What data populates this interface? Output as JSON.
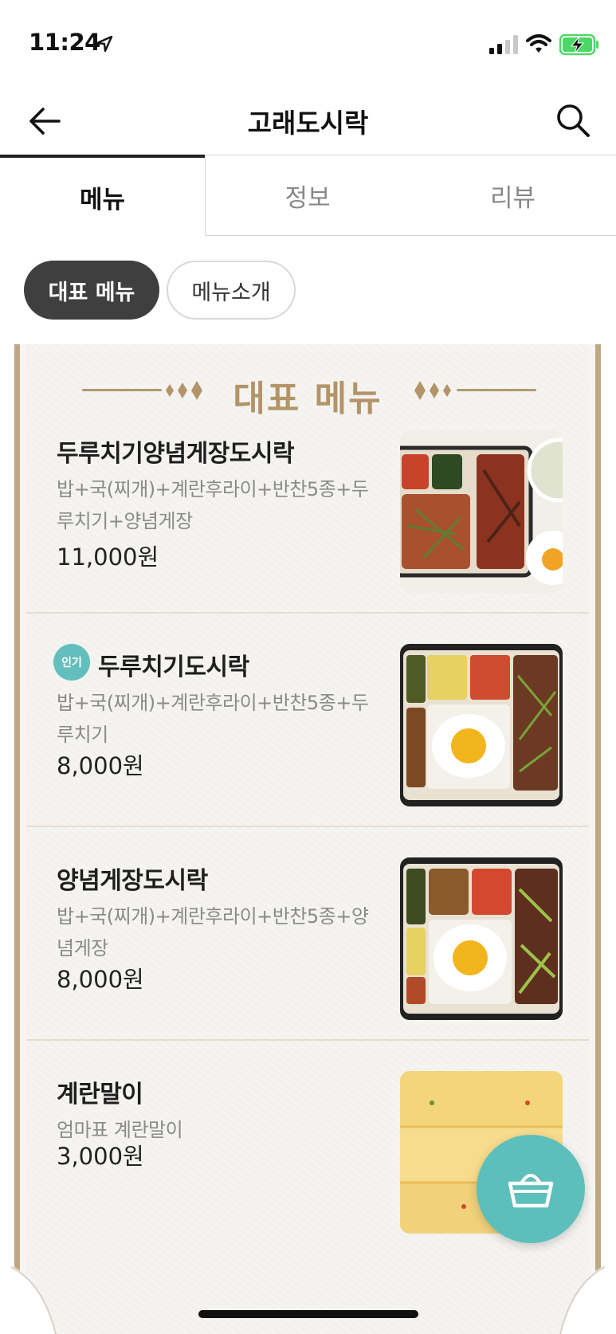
{
  "status": {
    "time": "11:24"
  },
  "header": {
    "title": "고래도시락"
  },
  "tabs": [
    {
      "label": "메뉴"
    },
    {
      "label": "정보"
    },
    {
      "label": "리뷰"
    }
  ],
  "chips": [
    {
      "label": "대표 메뉴"
    },
    {
      "label": "메뉴소개"
    }
  ],
  "board": {
    "title": "대표 메뉴"
  },
  "menu_items": [
    {
      "name": "두루치기양념게장도시락",
      "desc": "밥+국(찌개)+계란후라이+반찬5종+두루치기+양념게장",
      "price": "11,000원",
      "badge": ""
    },
    {
      "name": "두루치기도시락",
      "desc": "밥+국(찌개)+계란후라이+반찬5종+두루치기",
      "price": "8,000원",
      "badge": "인기"
    },
    {
      "name": "양념게장도시락",
      "desc": "밥+국(찌개)+계란후라이+반찬5종+양념게장",
      "price": "8,000원",
      "badge": ""
    },
    {
      "name": "계란말이",
      "desc": "엄마표 계란말이",
      "price": "3,000원",
      "badge": ""
    }
  ],
  "icons": {
    "back": "arrow-left-icon",
    "search": "search-icon",
    "cart": "basket-icon"
  },
  "colors": {
    "accent": "#5dbfbb",
    "board_gold": "#b39468",
    "chip_active": "#3f3f3f"
  }
}
